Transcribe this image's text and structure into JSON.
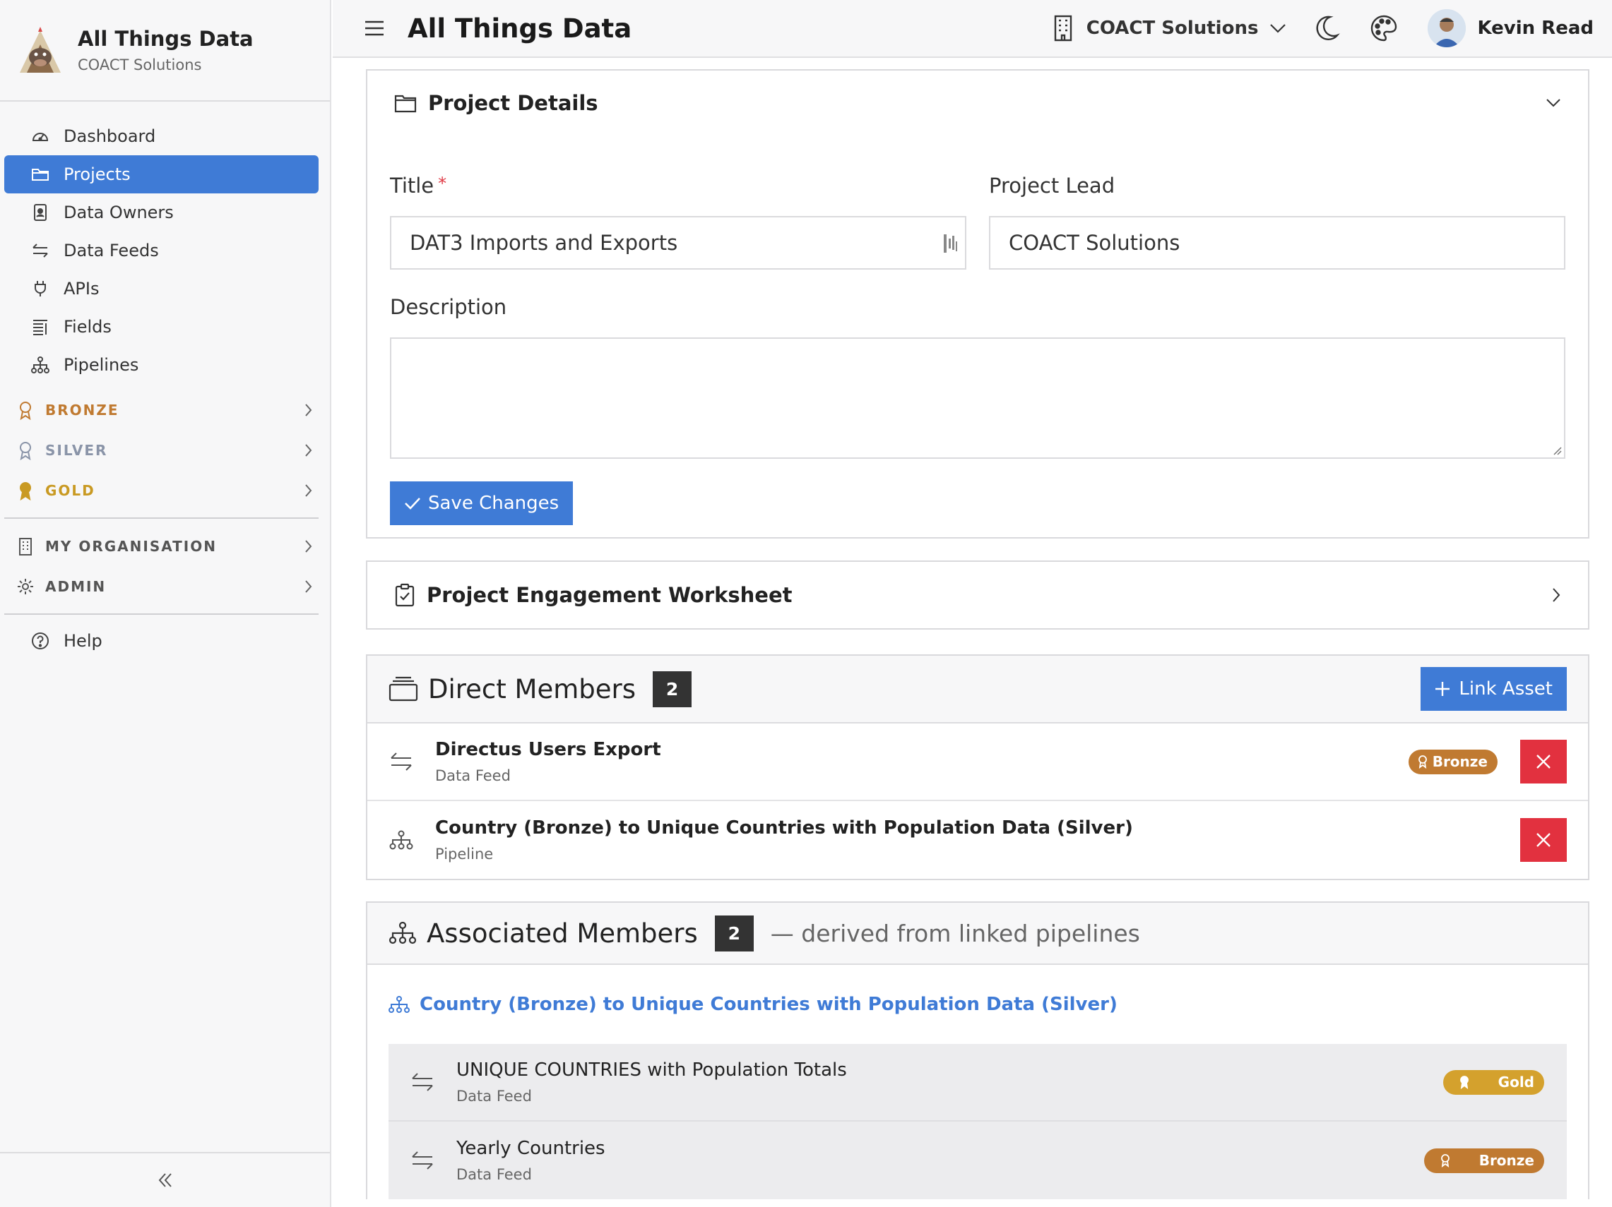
{
  "brand": {
    "title": "All Things Data",
    "subtitle": "COACT Solutions"
  },
  "sidebar": {
    "items": [
      {
        "label": "Dashboard",
        "icon": "gauge-icon"
      },
      {
        "label": "Projects",
        "icon": "folder-icon",
        "active": true
      },
      {
        "label": "Data Owners",
        "icon": "id-badge-icon"
      },
      {
        "label": "Data Feeds",
        "icon": "arrows-exchange-icon"
      },
      {
        "label": "APIs",
        "icon": "plug-icon"
      },
      {
        "label": "Fields",
        "icon": "list-icon"
      },
      {
        "label": "Pipelines",
        "icon": "sitemap-icon"
      }
    ],
    "tiers": [
      {
        "label": "BRONZE",
        "color": "#c07a31"
      },
      {
        "label": "SILVER",
        "color": "#8a94a8"
      },
      {
        "label": "GOLD",
        "color": "#c99a23"
      }
    ],
    "org_groups": [
      {
        "label": "MY ORGANISATION"
      },
      {
        "label": "ADMIN"
      }
    ],
    "help": "Help"
  },
  "topbar": {
    "title": "All Things Data",
    "org": "COACT Solutions",
    "user": "Kevin Read"
  },
  "details": {
    "heading": "Project Details",
    "title_label": "Title",
    "required_mark": "*",
    "title_value": "DAT3 Imports and Exports",
    "lead_label": "Project Lead",
    "lead_value": "COACT Solutions",
    "description_label": "Description",
    "description_value": "",
    "save_label": "Save Changes"
  },
  "worksheet": {
    "heading": "Project Engagement Worksheet"
  },
  "direct": {
    "heading": "Direct Members",
    "count": "2",
    "link_label": "Link Asset",
    "members": [
      {
        "name": "Directus Users Export",
        "type": "Data Feed",
        "badge": "Bronze"
      },
      {
        "name": "Country (Bronze) to Unique Countries with Population Data (Silver)",
        "type": "Pipeline"
      }
    ]
  },
  "associated": {
    "heading": "Associated Members",
    "count": "2",
    "note": "— derived from linked pipelines",
    "pipeline": "Country (Bronze) to Unique Countries with Population Data (Silver)",
    "members": [
      {
        "name": "UNIQUE COUNTRIES with Population Totals",
        "type": "Data Feed",
        "badge": "Gold"
      },
      {
        "name": "Yearly Countries",
        "type": "Data Feed",
        "badge": "Bronze"
      }
    ]
  },
  "colors": {
    "accent": "#3f7bd6",
    "danger": "#e2313f",
    "bronze": "#c07a31",
    "gold": "#d4a12d"
  }
}
